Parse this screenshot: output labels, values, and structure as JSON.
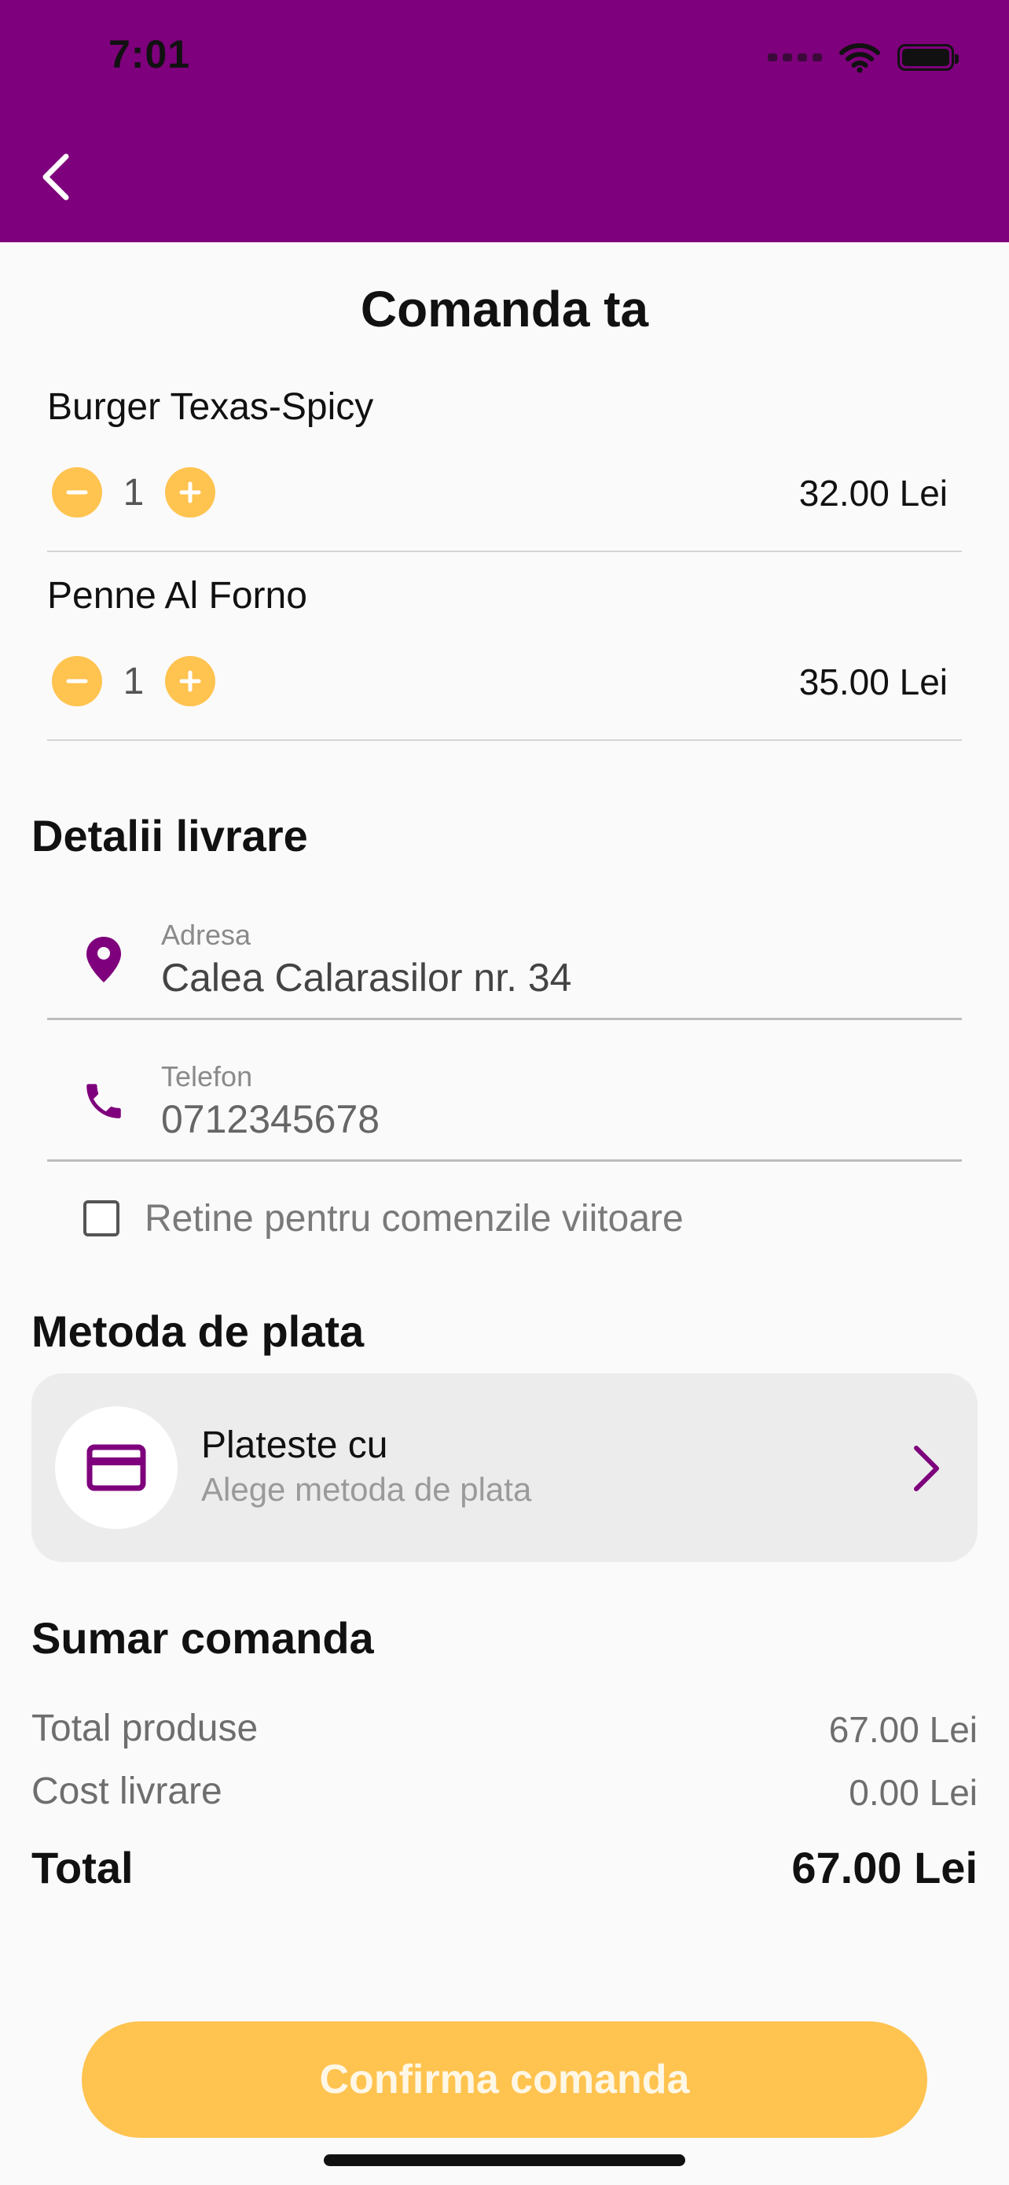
{
  "status_bar": {
    "time": "7:01"
  },
  "page": {
    "title": "Comanda ta"
  },
  "order_items": [
    {
      "name": "Burger Texas-Spicy",
      "quantity": "1",
      "price": "32.00 Lei"
    },
    {
      "name": "Penne Al Forno",
      "quantity": "1",
      "price": "35.00 Lei"
    }
  ],
  "delivery": {
    "section_title": "Detalii livrare",
    "address_label": "Adresa",
    "address_value": "Calea Calarasilor nr. 34",
    "phone_label": "Telefon",
    "phone_value": "0712345678",
    "remember_label": "Retine pentru comenzile viitoare"
  },
  "payment": {
    "section_title": "Metoda de plata",
    "title": "Plateste cu",
    "subtitle": "Alege metoda de plata"
  },
  "summary": {
    "section_title": "Sumar comanda",
    "products_label": "Total produse",
    "products_value": "67.00 Lei",
    "delivery_label": "Cost livrare",
    "delivery_value": "0.00 Lei",
    "total_label": "Total",
    "total_value": "67.00 Lei"
  },
  "actions": {
    "confirm_label": "Confirma comanda"
  },
  "icons": {
    "back": "chevron-left-icon",
    "minus": "minus-icon",
    "plus": "plus-icon",
    "location": "location-pin-icon",
    "phone": "phone-icon",
    "card": "credit-card-icon",
    "chevron_right": "chevron-right-icon"
  },
  "colors": {
    "brand_purple": "#7e007c",
    "accent_yellow": "#ffc350",
    "background": "#fafafa",
    "card_background": "#ececec"
  }
}
